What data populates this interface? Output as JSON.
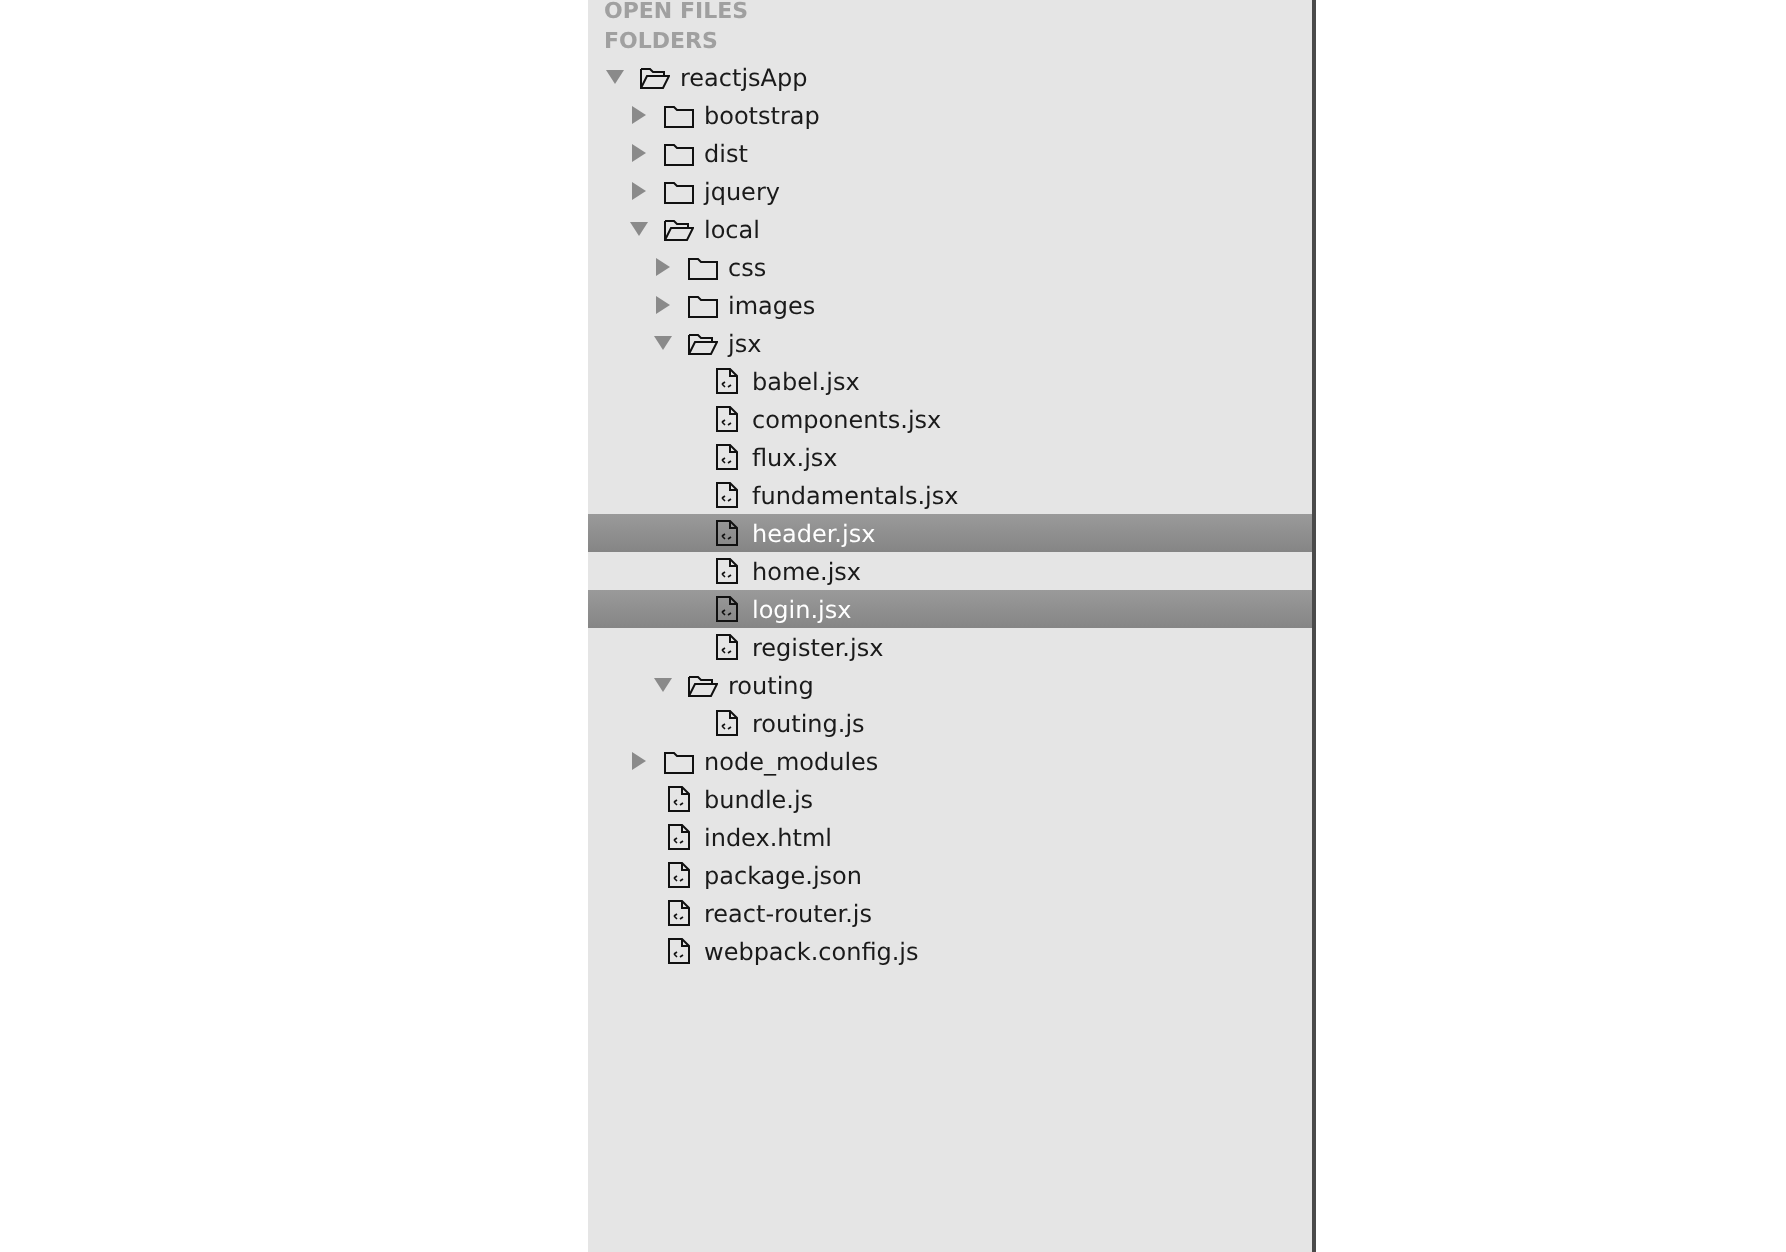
{
  "sidebar": {
    "sections": [
      "OPEN FILES",
      "FOLDERS"
    ],
    "tree": [
      {
        "kind": "folder",
        "name": "reactjsApp",
        "expanded": true,
        "children": [
          {
            "kind": "folder",
            "name": "bootstrap",
            "expanded": false
          },
          {
            "kind": "folder",
            "name": "dist",
            "expanded": false
          },
          {
            "kind": "folder",
            "name": "jquery",
            "expanded": false
          },
          {
            "kind": "folder",
            "name": "local",
            "expanded": true,
            "children": [
              {
                "kind": "folder",
                "name": "css",
                "expanded": false
              },
              {
                "kind": "folder",
                "name": "images",
                "expanded": false
              },
              {
                "kind": "folder",
                "name": "jsx",
                "expanded": true,
                "children": [
                  {
                    "kind": "file",
                    "name": "babel.jsx",
                    "selected": false
                  },
                  {
                    "kind": "file",
                    "name": "components.jsx",
                    "selected": false
                  },
                  {
                    "kind": "file",
                    "name": "flux.jsx",
                    "selected": false
                  },
                  {
                    "kind": "file",
                    "name": "fundamentals.jsx",
                    "selected": false
                  },
                  {
                    "kind": "file",
                    "name": "header.jsx",
                    "selected": true
                  },
                  {
                    "kind": "file",
                    "name": "home.jsx",
                    "selected": false
                  },
                  {
                    "kind": "file",
                    "name": "login.jsx",
                    "selected": true
                  },
                  {
                    "kind": "file",
                    "name": "register.jsx",
                    "selected": false
                  }
                ]
              },
              {
                "kind": "folder",
                "name": "routing",
                "expanded": true,
                "children": [
                  {
                    "kind": "file",
                    "name": "routing.js",
                    "selected": false
                  }
                ]
              }
            ]
          },
          {
            "kind": "folder",
            "name": "node_modules",
            "expanded": false
          },
          {
            "kind": "file",
            "name": "bundle.js",
            "selected": false
          },
          {
            "kind": "file",
            "name": "index.html",
            "selected": false
          },
          {
            "kind": "file",
            "name": "package.json",
            "selected": false
          },
          {
            "kind": "file",
            "name": "react-router.js",
            "selected": false
          },
          {
            "kind": "file",
            "name": "webpack.config.js",
            "selected": false
          }
        ]
      }
    ]
  }
}
